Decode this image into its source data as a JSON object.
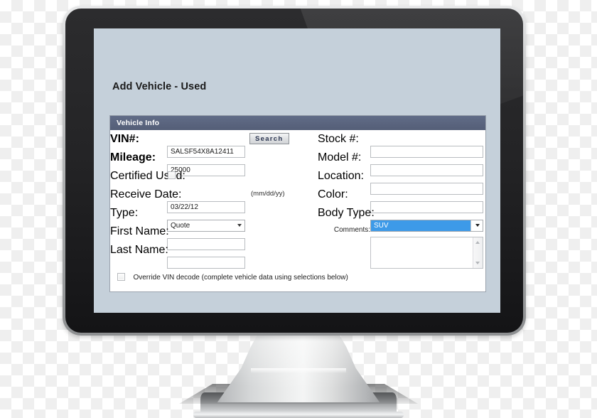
{
  "page": {
    "title": "Add Vehicle - Used"
  },
  "panel": {
    "header": "Vehicle Info",
    "left_fields": [
      {
        "label": "VIN#:",
        "value": "SALSF54X8A12411",
        "type": "text"
      },
      {
        "label": "Mileage:",
        "value": "25000",
        "type": "text"
      },
      {
        "label": "Certified Used:",
        "value": "",
        "type": "checkbox",
        "checked": false
      },
      {
        "label": "Receive Date:",
        "value": "03/22/12",
        "type": "text"
      },
      {
        "label": "Type:",
        "value": "Quote",
        "type": "select"
      },
      {
        "label": "First Name:",
        "value": "",
        "type": "text"
      },
      {
        "label": "Last Name:",
        "value": "",
        "type": "text"
      }
    ],
    "right_fields": [
      {
        "label": "Stock #:",
        "value": "",
        "type": "text"
      },
      {
        "label": "Model #:",
        "value": "",
        "type": "text"
      },
      {
        "label": "Location:",
        "value": "",
        "type": "text"
      },
      {
        "label": "Color:",
        "value": "",
        "type": "text"
      },
      {
        "label": "Body Type:",
        "value": "SUV",
        "type": "select",
        "selected": true
      }
    ],
    "comments": {
      "label": "Comments:",
      "value": ""
    },
    "search_button": "Search",
    "date_format_hint": "(mm/dd/yy)",
    "override": {
      "label": "Override VIN decode (complete vehicle data using selections below)",
      "checked": false
    }
  },
  "colors": {
    "screen_background": "#c5d0da",
    "panel_header": "#545e77",
    "selection_highlight": "#3d9ae8",
    "bezel": "#1a1a1c",
    "stand": "#bfc1c3"
  }
}
